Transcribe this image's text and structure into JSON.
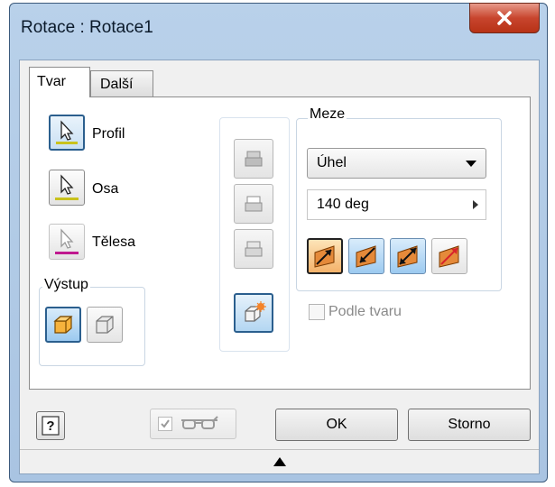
{
  "window": {
    "title": "Rotace : Rotace1"
  },
  "tabs": [
    {
      "label": "Tvar"
    },
    {
      "label": "Další"
    }
  ],
  "selectors": [
    {
      "label": "Profil",
      "underline_color": "#c9c21d"
    },
    {
      "label": "Osa",
      "underline_color": "#c9c21d"
    },
    {
      "label": "Tělesa",
      "underline_color": "#c0198f"
    }
  ],
  "output_group": {
    "title": "Výstup"
  },
  "extents_group": {
    "title": "Meze",
    "type_selected": "Úhel",
    "angle_value": "140 deg"
  },
  "match_shape": {
    "label": "Podle tvaru",
    "checked": false
  },
  "buttons": {
    "ok": "OK",
    "cancel": "Storno"
  },
  "colors": {
    "accent": "#2b5f8e",
    "highlight": "#f6b23c",
    "close": "#c8452e"
  },
  "icons": {
    "help": "help-icon",
    "preview": "glasses-icon",
    "expand": "triangle-up-icon"
  }
}
